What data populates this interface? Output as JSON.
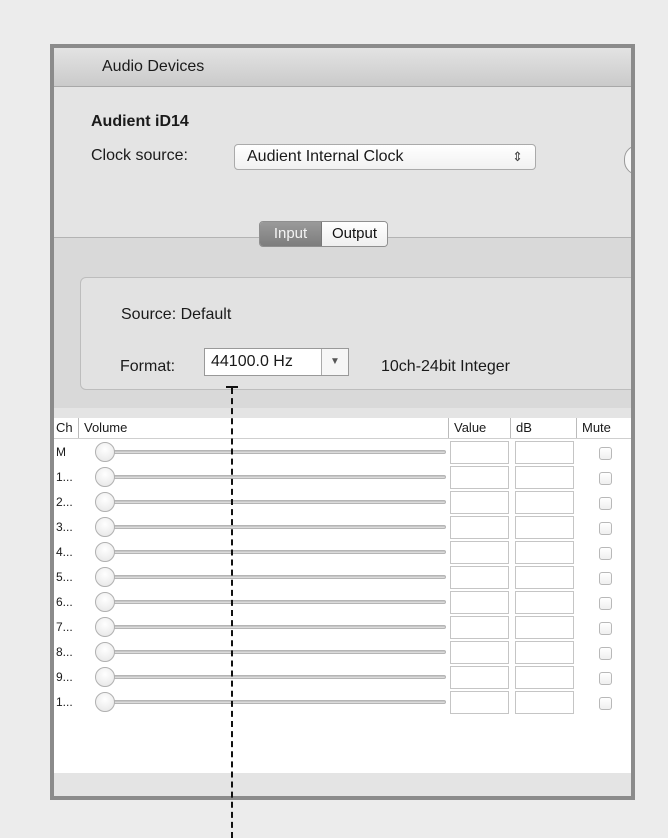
{
  "window": {
    "title": "Audio Devices"
  },
  "device": {
    "name": "Audient iD14",
    "clock_label": "Clock source:",
    "clock_value": "Audient Internal Clock",
    "clock_arrows": "⇕"
  },
  "tabs": {
    "input": "Input",
    "output": "Output",
    "selected": "Input"
  },
  "stream": {
    "source_label": "Source:",
    "source_value": "Default",
    "format_label": "Format:",
    "format_value": "44100.0 Hz",
    "format_desc": "10ch-24bit Integer"
  },
  "table": {
    "headers": {
      "ch": "Ch",
      "volume": "Volume",
      "value": "Value",
      "db": "dB",
      "mute": "Mute"
    },
    "rows": [
      "M",
      "1...",
      "2...",
      "3...",
      "4...",
      "5...",
      "6...",
      "7...",
      "8...",
      "9...",
      "1..."
    ]
  }
}
